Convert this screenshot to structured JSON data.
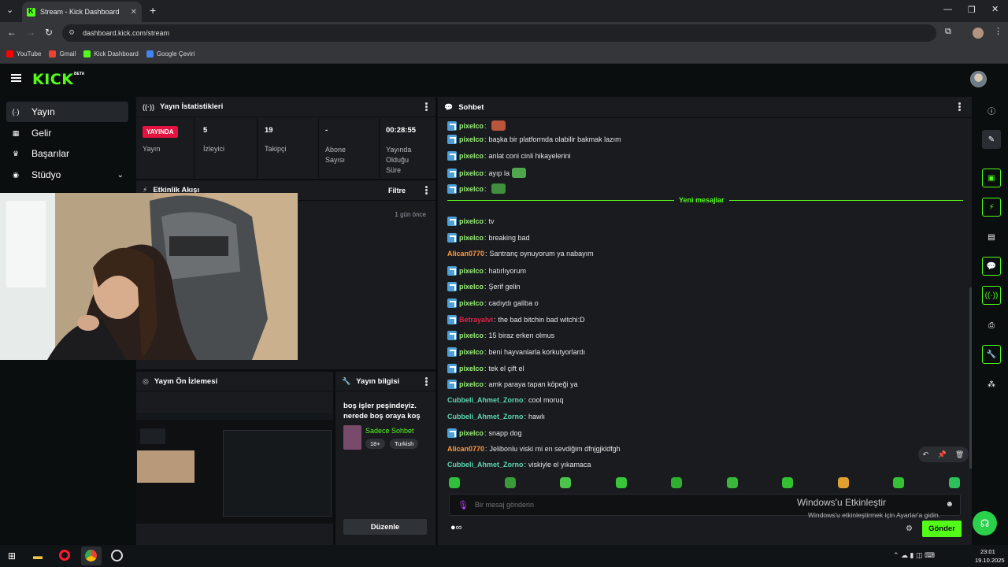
{
  "browser": {
    "tab_title": "Stream - Kick Dashboard",
    "address": "dashboard.kick.com/stream",
    "bookmarks": [
      {
        "label": "YouTube",
        "color": "#ff0000"
      },
      {
        "label": "Gmail",
        "color": "#ea4335"
      },
      {
        "label": "Kick Dashboard",
        "color": "#53fc18"
      },
      {
        "label": "Google Çeviri",
        "color": "#4285f4"
      }
    ]
  },
  "header": {
    "logo": "KICK",
    "beta": "BETA"
  },
  "sidebar": {
    "items": [
      {
        "label": "Yayın",
        "icon": "((·))"
      },
      {
        "label": "Gelir",
        "icon": "▣"
      },
      {
        "label": "Başarılar",
        "icon": "🏆"
      },
      {
        "label": "Stüdyo",
        "icon": "◉"
      }
    ]
  },
  "stats": {
    "title": "Yayın İstatistikleri",
    "live_badge": "YAYINDA",
    "cols": [
      {
        "value": "",
        "label": "Yayın"
      },
      {
        "value": "5",
        "label": "İzleyici"
      },
      {
        "value": "19",
        "label": "Takipçi"
      },
      {
        "value": "-",
        "label": "Abone Sayısı"
      },
      {
        "value": "00:28:55",
        "label": "Yayında Olduğu Süre"
      }
    ]
  },
  "activity": {
    "title": "Etkinlik Akışı",
    "filter": "Filtre",
    "time": "1 gün önce"
  },
  "preview": {
    "title": "Yayın Ön İzlemesi"
  },
  "info": {
    "title": "Yayın bilgisi",
    "stream_title": "boş işler peşindeyiz. nerede boş oraya koş",
    "category": "Sadece Sohbet",
    "tags": [
      "18+",
      "Turkish"
    ],
    "edit_button": "Düzenle"
  },
  "chat": {
    "title": "Sohbet",
    "new_messages": "Yeni mesajlar",
    "messages": [
      {
        "user": "pixelco",
        "text": "",
        "color": "#9bf07a",
        "badge": true,
        "emote": "#b8553a"
      },
      {
        "user": "pixelco",
        "text": "başka bir platformda olabilir bakmak lazım",
        "color": "#9bf07a",
        "badge": true
      },
      {
        "user": "pixelco",
        "text": "anlat coni cinli hikayelerini",
        "color": "#9bf07a",
        "badge": true
      },
      {
        "user": "pixelco",
        "text": "ayıp la",
        "color": "#9bf07a",
        "badge": true,
        "emote": "#4fa64f"
      },
      {
        "user": "pixelco",
        "text": "",
        "color": "#9bf07a",
        "badge": true,
        "emote": "#3f8f3f"
      },
      {
        "user": "pixelco",
        "text": "tv",
        "color": "#9bf07a",
        "badge": true
      },
      {
        "user": "pixelco",
        "text": "breaking bad",
        "color": "#9bf07a",
        "badge": true
      },
      {
        "user": "Alican0770",
        "text": "Santranç oynuyorum ya nabayım",
        "color": "#ff9a3c",
        "badge": false
      },
      {
        "user": "pixelco",
        "text": "hatırlıyorum",
        "color": "#9bf07a",
        "badge": true
      },
      {
        "user": "pixelco",
        "text": "Şerif gelin",
        "color": "#9bf07a",
        "badge": true
      },
      {
        "user": "pixelco",
        "text": "cadıydı galiba o",
        "color": "#9bf07a",
        "badge": true
      },
      {
        "user": "Betrayalvi",
        "text": "the bad bitchin bad witchi:D",
        "color": "#e0234c",
        "badge": true
      },
      {
        "user": "pixelco",
        "text": "15 biraz erken olmus",
        "color": "#9bf07a",
        "badge": true
      },
      {
        "user": "pixelco",
        "text": "beni hayvanlarla korkutyorlardı",
        "color": "#9bf07a",
        "badge": true
      },
      {
        "user": "pixelco",
        "text": "tek el çift el",
        "color": "#9bf07a",
        "badge": true
      },
      {
        "user": "pixelco",
        "text": "amk paraya tapan köpeği ya",
        "color": "#9bf07a",
        "badge": true
      },
      {
        "user": "Cubbeli_Ahmet_Zorno",
        "text": "cool moruq",
        "color": "#5fd6b0",
        "badge": false
      },
      {
        "user": "Cubbeli_Ahmet_Zorno",
        "text": "hawlı",
        "color": "#5fd6b0",
        "badge": false
      },
      {
        "user": "pixelco",
        "text": "snapp dog",
        "color": "#9bf07a",
        "badge": true
      },
      {
        "user": "Alican0770",
        "text": "Jelibonlu viski mi en sevdiğim dfnjgjkldfgh",
        "color": "#ff9a3c",
        "badge": false
      },
      {
        "user": "Cubbeli_Ahmet_Zorno",
        "text": "viskiyle el yıkamaca",
        "color": "#5fd6b0",
        "badge": false
      }
    ],
    "placeholder": "Bir mesaj gönderin",
    "send": "Gönder",
    "emote_colors": [
      "#2fbf3c",
      "#3a9a3a",
      "#4cc44c",
      "#39c639",
      "#2fae2f",
      "#3ab83a",
      "#33c133",
      "#e0a030",
      "#36c036",
      "#2fbf5a"
    ]
  },
  "overlay": {
    "activate_title": "Windows'u Etkinleştir",
    "activate_sub": "Windows'u etkinleştirmek için Ayarlar'a gidin."
  },
  "taskbar": {
    "time": "23:01",
    "date": "19.10.2025"
  }
}
